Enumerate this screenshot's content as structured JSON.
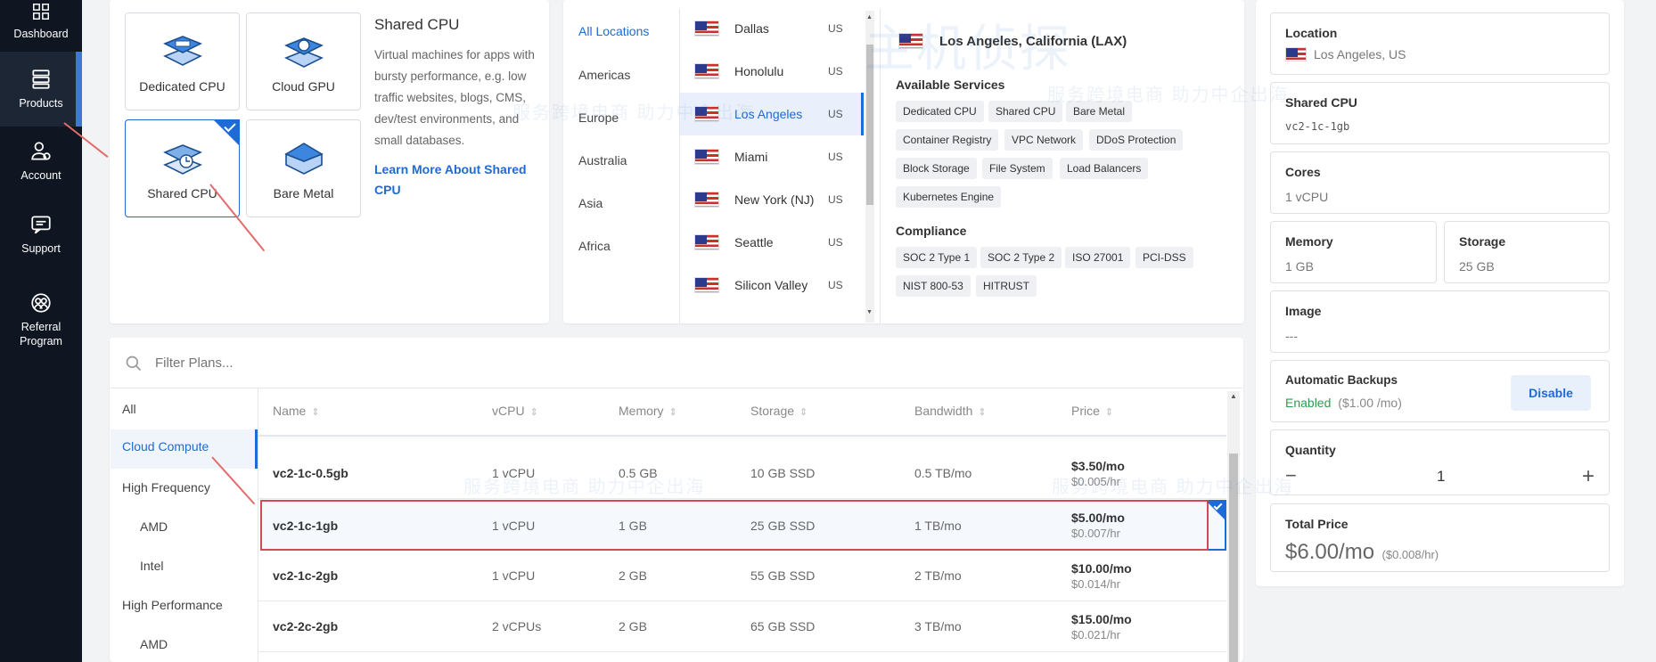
{
  "sidebar": {
    "items": [
      {
        "label": "Dashboard",
        "icon": "dashboard-icon"
      },
      {
        "label": "Products",
        "icon": "products-icon"
      },
      {
        "label": "Account",
        "icon": "account-icon"
      },
      {
        "label": "Support",
        "icon": "support-icon"
      },
      {
        "label": "Referral Program",
        "icon": "referral-icon"
      }
    ],
    "active": "Products"
  },
  "products": {
    "cards": [
      "Dedicated CPU",
      "Cloud GPU",
      "Shared CPU",
      "Bare Metal"
    ],
    "selected": "Shared CPU",
    "title": "Shared CPU",
    "description": "Virtual machines for apps with bursty performance, e.g. low traffic websites, blogs, CMS, dev/test environments, and small databases.",
    "link": "Learn More About Shared CPU"
  },
  "locations": {
    "regions": [
      "All Locations",
      "Americas",
      "Europe",
      "Australia",
      "Asia",
      "Africa"
    ],
    "active_region": "All Locations",
    "cities": [
      {
        "name": "Dallas",
        "code": "US"
      },
      {
        "name": "Honolulu",
        "code": "US"
      },
      {
        "name": "Los Angeles",
        "code": "US"
      },
      {
        "name": "Miami",
        "code": "US"
      },
      {
        "name": "New York (NJ)",
        "code": "US"
      },
      {
        "name": "Seattle",
        "code": "US"
      },
      {
        "name": "Silicon Valley",
        "code": "US"
      }
    ],
    "selected_city": "Los Angeles",
    "detail_title": "Los Angeles, California (LAX)",
    "services_heading": "Available Services",
    "services": [
      "Dedicated CPU",
      "Shared CPU",
      "Bare Metal",
      "Container Registry",
      "VPC Network",
      "DDoS Protection",
      "Block Storage",
      "File System",
      "Load Balancers",
      "Kubernetes Engine"
    ],
    "compliance_heading": "Compliance",
    "compliance": [
      "SOC 2 Type 1",
      "SOC 2 Type 2",
      "ISO 27001",
      "PCI-DSS",
      "NIST 800-53",
      "HITRUST"
    ]
  },
  "plans": {
    "filter_placeholder": "Filter Plans...",
    "categories": [
      "All",
      "Cloud Compute",
      "High Frequency",
      "AMD",
      "Intel",
      "High Performance",
      "AMD"
    ],
    "active_category": "Cloud Compute",
    "columns": [
      "Name",
      "vCPU",
      "Memory",
      "Storage",
      "Bandwidth",
      "Price"
    ],
    "rows": [
      {
        "name": "vc2-1c-0.5gb",
        "vcpu": "1 vCPU",
        "memory": "0.5 GB",
        "storage": "10 GB SSD",
        "bandwidth": "0.5 TB/mo",
        "price": "$3.50/mo",
        "hourly": "$0.005/hr"
      },
      {
        "name": "vc2-1c-1gb",
        "vcpu": "1 vCPU",
        "memory": "1 GB",
        "storage": "25 GB SSD",
        "bandwidth": "1 TB/mo",
        "price": "$5.00/mo",
        "hourly": "$0.007/hr"
      },
      {
        "name": "vc2-1c-2gb",
        "vcpu": "1 vCPU",
        "memory": "2 GB",
        "storage": "55 GB SSD",
        "bandwidth": "2 TB/mo",
        "price": "$10.00/mo",
        "hourly": "$0.014/hr"
      },
      {
        "name": "vc2-2c-2gb",
        "vcpu": "2 vCPUs",
        "memory": "2 GB",
        "storage": "65 GB SSD",
        "bandwidth": "3 TB/mo",
        "price": "$15.00/mo",
        "hourly": "$0.021/hr"
      }
    ],
    "selected_row": "vc2-1c-1gb"
  },
  "summary": {
    "location_label": "Location",
    "location_value": "Los Angeles, US",
    "plan_label": "Shared CPU",
    "plan_value": "vc2-1c-1gb",
    "cores_label": "Cores",
    "cores_value": "1 vCPU",
    "memory_label": "Memory",
    "memory_value": "1 GB",
    "storage_label": "Storage",
    "storage_value": "25 GB",
    "image_label": "Image",
    "image_value": "---",
    "backups_label": "Automatic Backups",
    "backups_status": "Enabled",
    "backups_price": "($1.00 /mo)",
    "backups_button": "Disable",
    "quantity_label": "Quantity",
    "quantity_value": "1",
    "qty_minus": "−",
    "qty_plus": "+",
    "total_label": "Total Price",
    "total_value": "$6.00/mo",
    "total_hourly": "($0.008/hr)"
  },
  "watermark": {
    "brand": "主机侦探",
    "slogan": "服务跨境电商 助力中企出海"
  },
  "colors": {
    "accent": "#1e6ad6",
    "sidebar": "#0f1621",
    "success": "#2e9b4e",
    "annotation": "#d24a5a"
  }
}
